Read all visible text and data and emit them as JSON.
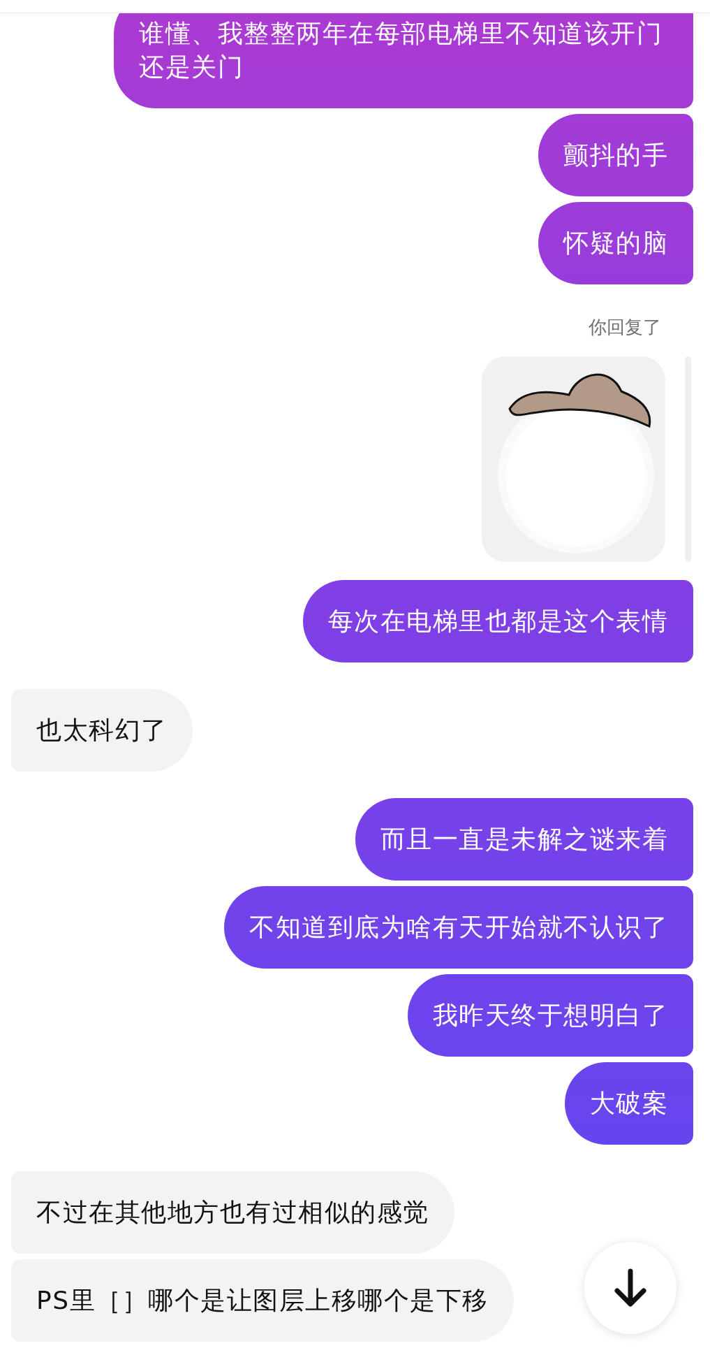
{
  "messages": [
    {
      "kind": "outgoing",
      "text": "谁懂、我整整两年在每部电梯里不知道该开门还是关门"
    },
    {
      "kind": "outgoing",
      "text": "颤抖的手"
    },
    {
      "kind": "outgoing",
      "text": "怀疑的脑"
    },
    {
      "kind": "reply_note",
      "text": "你回复了"
    },
    {
      "kind": "sticker"
    },
    {
      "kind": "outgoing",
      "text": "每次在电梯里也都是这个表情"
    },
    {
      "kind": "incoming",
      "text": "也太科幻了"
    },
    {
      "kind": "outgoing",
      "text": "而且一直是未解之谜来着"
    },
    {
      "kind": "outgoing",
      "text": "不知道到底为啥有天开始就不认识了"
    },
    {
      "kind": "outgoing",
      "text": "我昨天终于想明白了"
    },
    {
      "kind": "outgoing",
      "text": "大破案"
    },
    {
      "kind": "incoming",
      "text": "不过在其他地方也有过相似的感觉"
    },
    {
      "kind": "incoming",
      "text": "PS里［］哪个是让图层上移哪个是下移"
    }
  ]
}
